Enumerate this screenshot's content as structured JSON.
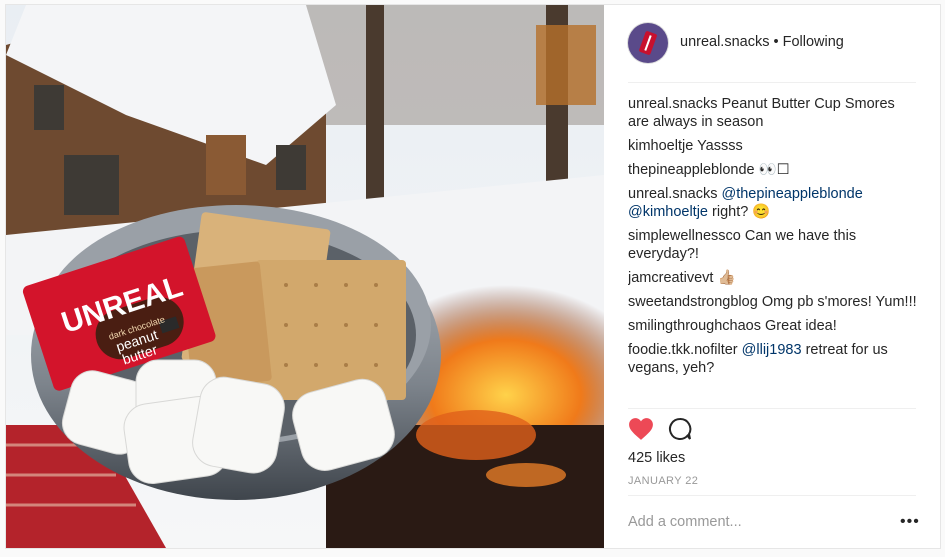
{
  "post": {
    "username": "unreal.snacks",
    "follow_status": "Following",
    "separator": "•",
    "likes_text": "425 likes",
    "date": "JANUARY 22",
    "add_comment_placeholder": "Add a comment...",
    "more_options": "•••"
  },
  "comments": [
    {
      "user": "unreal.snacks",
      "text": "Peanut Butter Cup Smores are always in season"
    },
    {
      "user": "kimhoeltje",
      "text": "Yassss"
    },
    {
      "user": "thepineappleblonde",
      "text": "👀☐"
    },
    {
      "user": "unreal.snacks",
      "mention1": "@thepineappleblonde",
      "mention2": "@kimhoeltje",
      "text": "right? 😊"
    },
    {
      "user": "simplewellnessco",
      "text": "Can we have this everyday?!"
    },
    {
      "user": "jamcreativevt",
      "text": "👍🏼"
    },
    {
      "user": "sweetandstrongblog",
      "text": "Omg pb s'mores! Yum!!!"
    },
    {
      "user": "smilingthroughchaos",
      "text": "Great idea!"
    },
    {
      "user": "foodie.tkk.nofilter",
      "mention1": "@llij1983",
      "text": "retreat for us vegans, yeh?"
    }
  ],
  "photo": {
    "package_brand": "UNREAL",
    "package_line1": "dark chocolate",
    "package_line2": "peanut",
    "package_line3": "butter"
  },
  "colors": {
    "heart": "#ed4956",
    "mention": "#003569",
    "text": "#262626",
    "muted": "#999999"
  },
  "icons": [
    "heart-icon",
    "comment-icon"
  ]
}
